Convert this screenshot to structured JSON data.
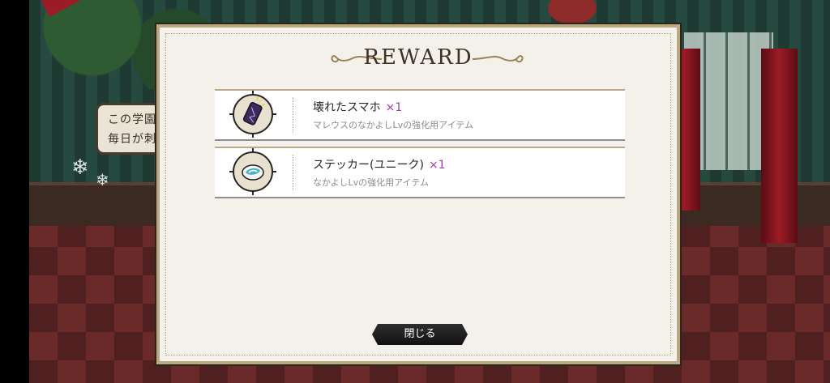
{
  "background": {
    "sign_lines": [
      "この学園に",
      "毎日が刺激"
    ]
  },
  "modal": {
    "title": "REWARD",
    "rewards": [
      {
        "name": "壊れたスマホ",
        "qty": "×1",
        "desc": "マレウスのなかよしLvの強化用アイテム",
        "icon": "broken-smartphone-icon"
      },
      {
        "name": "ステッカー(ユニーク)",
        "qty": "×1",
        "desc": "なかよしLvの強化用アイテム",
        "icon": "sticker-icon"
      }
    ],
    "close_label": "閉じる"
  },
  "colors": {
    "accent_qty": "#a23bb0",
    "button_bg": "#1c1c1c",
    "panel_bg": "#f4f1ea",
    "gold_border": "#bba984"
  }
}
